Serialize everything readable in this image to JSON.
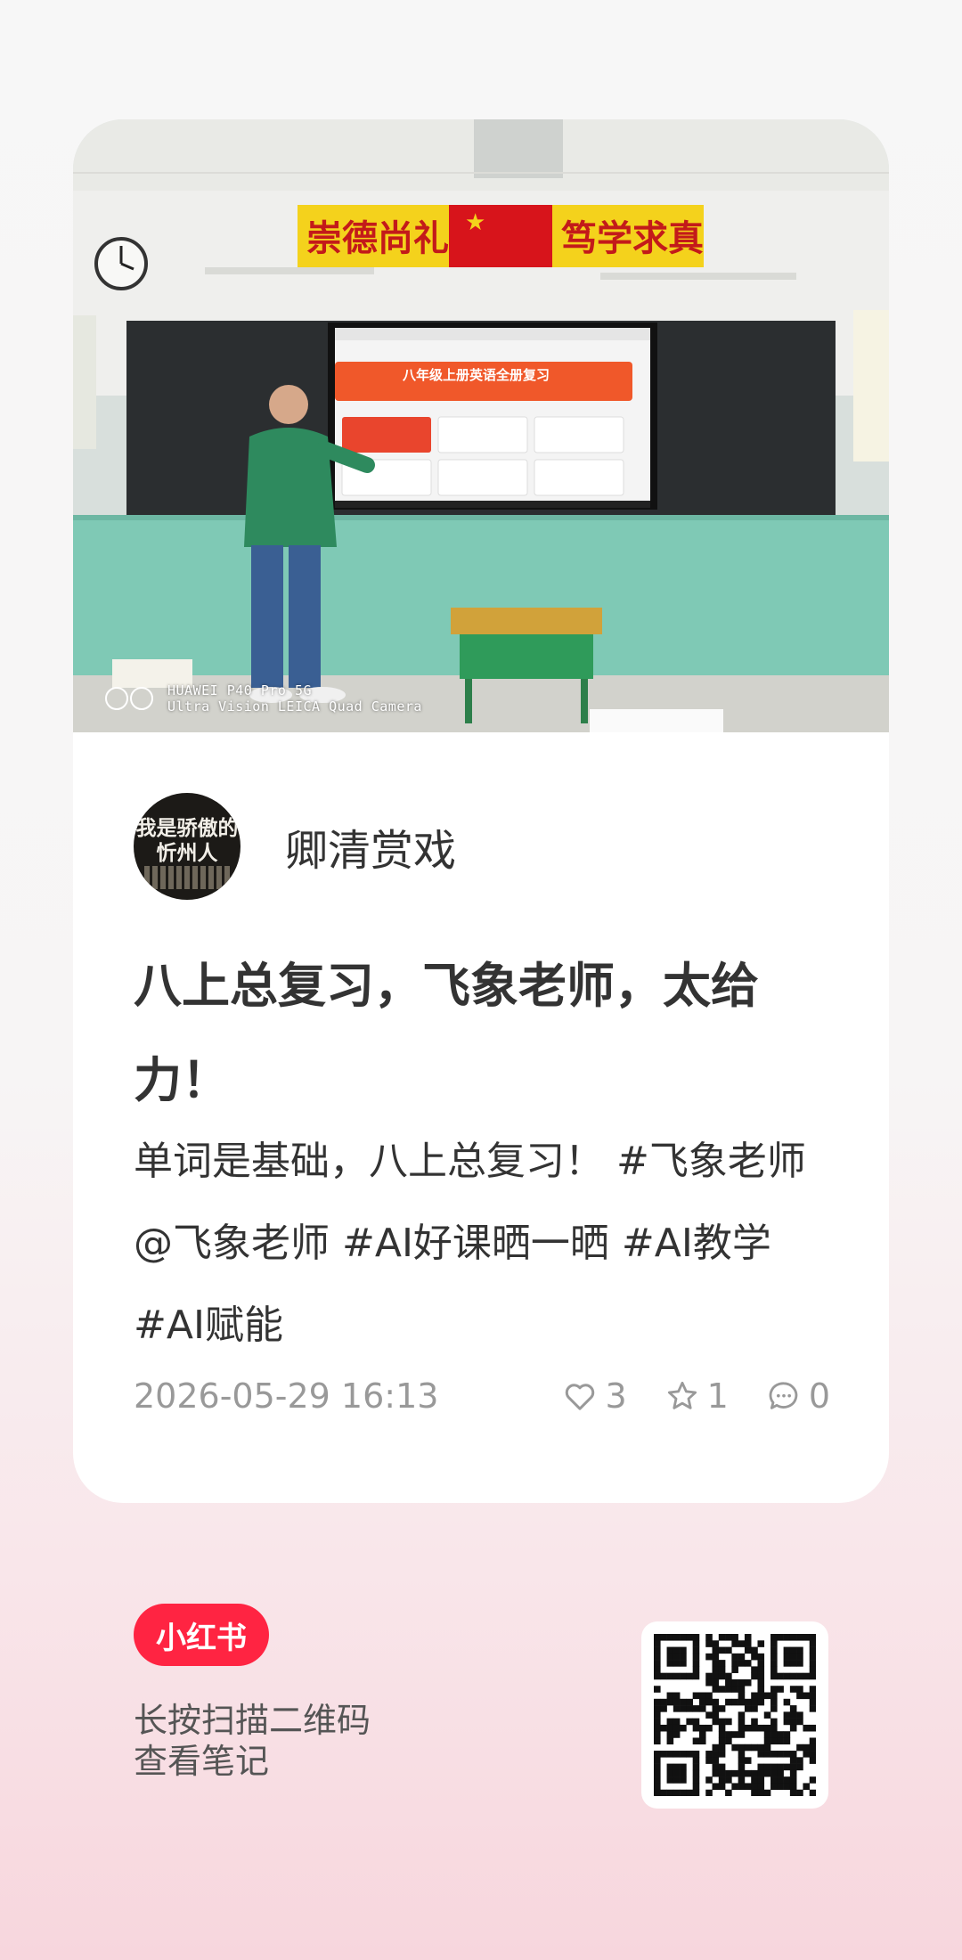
{
  "post": {
    "author_name": "卿清赏戏",
    "avatar_text_line1": "我是骄傲的",
    "avatar_text_line2": "忻州人",
    "title": "八上总复习，飞象老师，太给力！",
    "body": "单词是基础，八上总复习！ #飞象老师 @飞象老师  #AI好课晒一晒 #AI教学 #AI赋能",
    "date": "2026-05-29 16:13",
    "likes": "3",
    "collects": "1",
    "comments": "0"
  },
  "photo": {
    "banner_left": "崇德尚礼",
    "banner_right": "笃学求真",
    "screen_title": "八年级上册英语全册复习",
    "camera_line1": "HUAWEI P40 Pro 5G",
    "camera_line2": "Ultra Vision LEICA Quad Camera"
  },
  "footer": {
    "brand": "小红书",
    "scan_hint_line1": "长按扫描二维码",
    "scan_hint_line2": "查看笔记"
  },
  "colors": {
    "brand_red": "#ff2442",
    "banner_yellow": "#f4d21c",
    "banner_red": "#d7141b",
    "wall_green": "#7fc9b5"
  },
  "icons": [
    "heart-icon",
    "star-icon",
    "comment-icon",
    "camera-rings-icon",
    "qr-code"
  ]
}
